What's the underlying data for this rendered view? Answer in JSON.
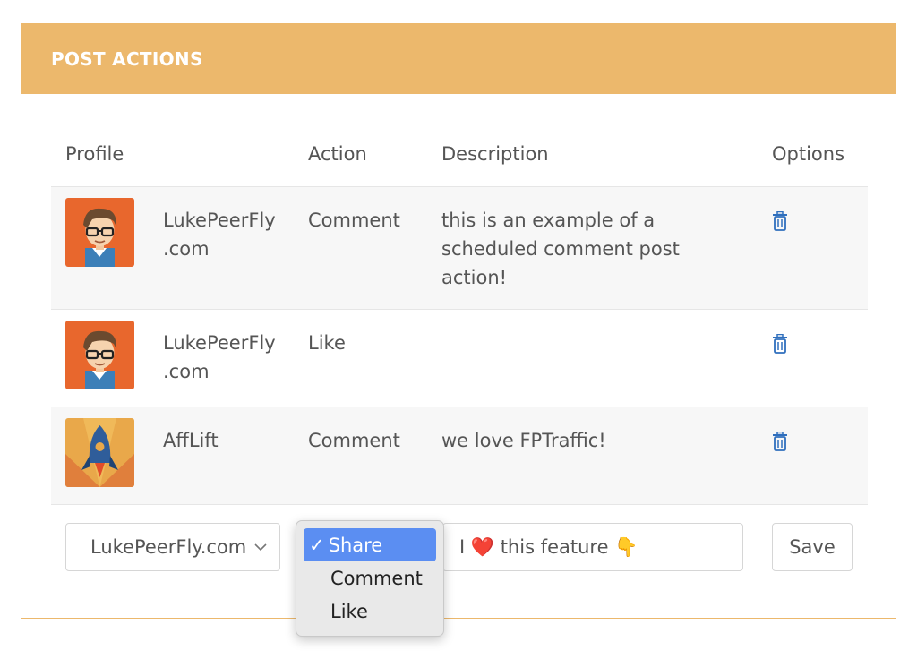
{
  "panel": {
    "title": "POST ACTIONS"
  },
  "table": {
    "headers": {
      "profile": "Profile",
      "action": "Action",
      "description": "Description",
      "options": "Options"
    },
    "rows": [
      {
        "avatar": "geek-avatar",
        "profile_line1": "LukePeerFly",
        "profile_line2": ".com",
        "action": "Comment",
        "description": "this is an example of a scheduled comment post action!",
        "option_icon": "trash-icon"
      },
      {
        "avatar": "geek-avatar",
        "profile_line1": "LukePeerFly",
        "profile_line2": ".com",
        "action": "Like",
        "description": "",
        "option_icon": "trash-icon"
      },
      {
        "avatar": "rocket-avatar",
        "profile_line1": "AffLift",
        "profile_line2": "",
        "action": "Comment",
        "description": "we love FPTraffic!",
        "option_icon": "trash-icon"
      }
    ]
  },
  "form": {
    "profile_select_value": "LukePeerFly.com",
    "description_value": "I ❤️ this feature 👇",
    "save_label": "Save"
  },
  "action_dropdown": {
    "options": [
      "Share",
      "Comment",
      "Like"
    ],
    "selected": "Share",
    "checkmark": "✓"
  },
  "colors": {
    "header": "#ecb86c",
    "selected_option": "#5b8ef2",
    "icon_blue": "#2f6fbd"
  }
}
